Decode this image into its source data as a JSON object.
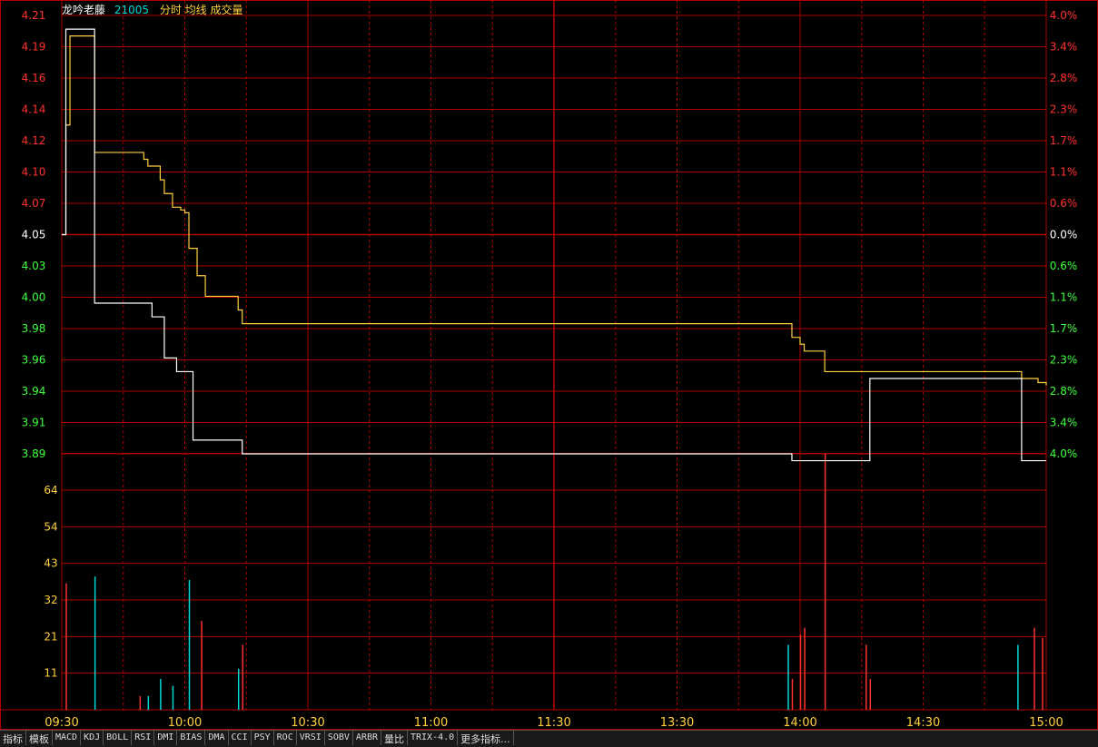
{
  "header": {
    "stock_name": "龙吟老藤",
    "volume": "21005",
    "indicators": "分时 均线 成交量"
  },
  "tabs": [
    "指标",
    "模板",
    "MACD",
    "KDJ",
    "BOLL",
    "RSI",
    "DMI",
    "BIAS",
    "DMA",
    "CCI",
    "PSY",
    "ROC",
    "VRSI",
    "SOBV",
    "ARBR",
    "量比",
    "TRIX-4.0",
    "更多指标..."
  ],
  "colors": {
    "grid": "#b00000",
    "price_line": "#ffffff",
    "avg_line": "#ffd040",
    "up": "#ff3030",
    "down": "#40ff40",
    "flat": "#ffffff",
    "volume_axis": "#ffd040",
    "volume_down": "#00d8d8",
    "time_axis": "#ffd040"
  },
  "chart_data": [
    {
      "type": "line",
      "name": "price-panel",
      "prev_close": 4.05,
      "ylim": [
        3.89,
        4.21
      ],
      "y_ticks_left": [
        "4.21",
        "4.19",
        "4.16",
        "4.14",
        "4.12",
        "4.10",
        "4.07",
        "4.05",
        "4.03",
        "4.00",
        "3.98",
        "3.96",
        "3.94",
        "3.91",
        "3.89"
      ],
      "y_ticks_right": [
        "4.0%",
        "3.4%",
        "2.8%",
        "2.3%",
        "1.7%",
        "1.1%",
        "0.6%",
        "0.0%",
        "0.6%",
        "1.1%",
        "1.7%",
        "2.3%",
        "2.8%",
        "3.4%",
        "4.0%"
      ],
      "x_ticks": [
        "09:30",
        "10:00",
        "10:30",
        "11:00",
        "11:30",
        "13:30",
        "14:00",
        "14:30",
        "15:00"
      ],
      "series": [
        {
          "points": [
            [
              0,
              4.05
            ],
            [
              1,
              4.2
            ],
            [
              7,
              4.2
            ],
            [
              8,
              4.0
            ],
            [
              21,
              4.0
            ],
            [
              22,
              3.99
            ],
            [
              24,
              3.99
            ],
            [
              25,
              3.96
            ],
            [
              27,
              3.96
            ],
            [
              28,
              3.95
            ],
            [
              31,
              3.95
            ],
            [
              32,
              3.9
            ],
            [
              43,
              3.9
            ],
            [
              44,
              3.89
            ],
            [
              177,
              3.89
            ],
            [
              178,
              3.885
            ],
            [
              196,
              3.885
            ],
            [
              197,
              3.945
            ],
            [
              233,
              3.945
            ],
            [
              234,
              3.885
            ],
            [
              240,
              3.885
            ]
          ]
        },
        {
          "points": [
            [
              0,
              4.05
            ],
            [
              1,
              4.13
            ],
            [
              2,
              4.195
            ],
            [
              7,
              4.195
            ],
            [
              8,
              4.11
            ],
            [
              18,
              4.11
            ],
            [
              20,
              4.105
            ],
            [
              21,
              4.1
            ],
            [
              23,
              4.1
            ],
            [
              24,
              4.09
            ],
            [
              25,
              4.08
            ],
            [
              27,
              4.07
            ],
            [
              29,
              4.068
            ],
            [
              30,
              4.066
            ],
            [
              31,
              4.04
            ],
            [
              33,
              4.02
            ],
            [
              34,
              4.02
            ],
            [
              35,
              4.005
            ],
            [
              42,
              4.005
            ],
            [
              43,
              3.995
            ],
            [
              44,
              3.985
            ],
            [
              176,
              3.985
            ],
            [
              178,
              3.975
            ],
            [
              180,
              3.97
            ],
            [
              181,
              3.965
            ],
            [
              185,
              3.965
            ],
            [
              186,
              3.95
            ],
            [
              233,
              3.95
            ],
            [
              234,
              3.945
            ],
            [
              238,
              3.942
            ],
            [
              240,
              3.94
            ]
          ]
        }
      ]
    },
    {
      "type": "bar",
      "name": "volume-panel",
      "ylim": [
        0,
        75
      ],
      "y_ticks": [
        "64",
        "54",
        "43",
        "32",
        "21",
        "11"
      ],
      "bars": [
        {
          "t": 1,
          "v": 37,
          "dir": "up"
        },
        {
          "t": 8,
          "v": 39,
          "dir": "down"
        },
        {
          "t": 19,
          "v": 4,
          "dir": "up"
        },
        {
          "t": 21,
          "v": 4,
          "dir": "down"
        },
        {
          "t": 24,
          "v": 9,
          "dir": "down"
        },
        {
          "t": 27,
          "v": 7,
          "dir": "down"
        },
        {
          "t": 31,
          "v": 38,
          "dir": "down"
        },
        {
          "t": 34,
          "v": 26,
          "dir": "up"
        },
        {
          "t": 43,
          "v": 12,
          "dir": "down"
        },
        {
          "t": 44,
          "v": 19,
          "dir": "up"
        },
        {
          "t": 177,
          "v": 19,
          "dir": "down"
        },
        {
          "t": 178,
          "v": 9,
          "dir": "up"
        },
        {
          "t": 180,
          "v": 22,
          "dir": "up"
        },
        {
          "t": 181,
          "v": 24,
          "dir": "up"
        },
        {
          "t": 186,
          "v": 75,
          "dir": "up"
        },
        {
          "t": 196,
          "v": 19,
          "dir": "up"
        },
        {
          "t": 197,
          "v": 9,
          "dir": "up"
        },
        {
          "t": 233,
          "v": 19,
          "dir": "down"
        },
        {
          "t": 237,
          "v": 24,
          "dir": "up"
        },
        {
          "t": 239,
          "v": 21,
          "dir": "up"
        }
      ]
    }
  ]
}
